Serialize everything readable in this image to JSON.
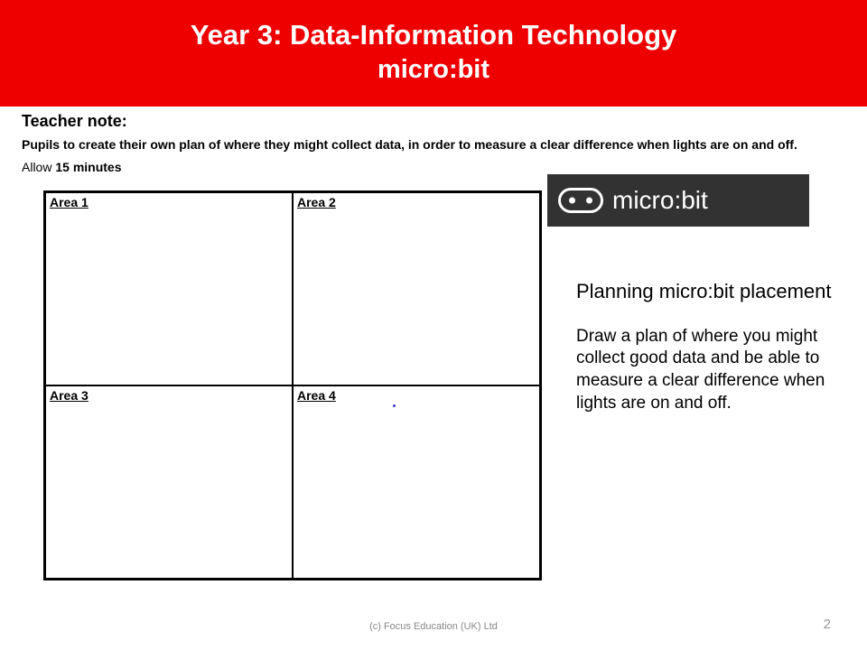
{
  "banner": {
    "line1": "Year 3: Data-Information Technology",
    "line2": "micro:bit"
  },
  "teacher_note": {
    "label": "Teacher note:",
    "body": "Pupils to create their own plan of where they might collect data, in order to measure a clear difference when lights are on and off.",
    "allow_prefix": "Allow ",
    "allow_bold": "15 minutes"
  },
  "grid": {
    "cells": [
      "Area 1",
      "Area 2",
      "Area 3",
      "Area 4"
    ]
  },
  "logo": {
    "text": "micro:bit"
  },
  "right": {
    "heading": "Planning micro:bit placement",
    "body": "Draw a plan of where you might collect good data and be able to measure a clear difference when lights are on and off."
  },
  "footer": {
    "copyright": "(c) Focus Education (UK) Ltd",
    "page": "2"
  }
}
